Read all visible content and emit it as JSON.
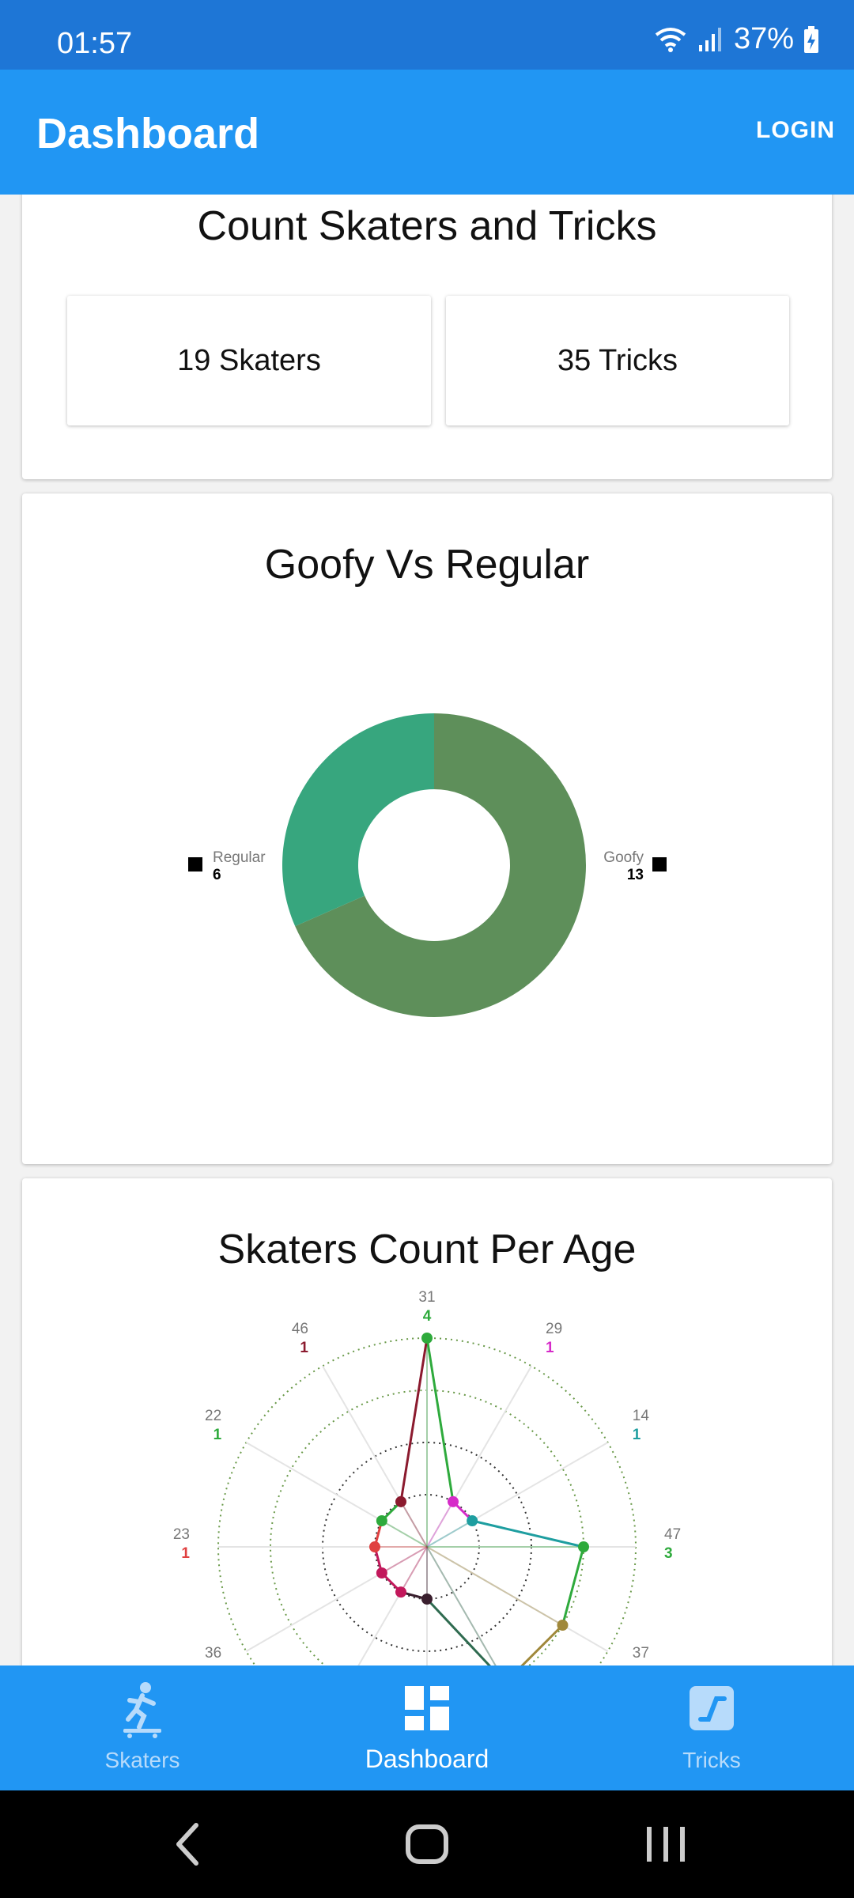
{
  "status_bar": {
    "time": "01:57",
    "battery": "37%"
  },
  "app_bar": {
    "title": "Dashboard",
    "login_label": "LOGIN"
  },
  "counts_card": {
    "title": "Count Skaters and Tricks",
    "skaters_label": "19 Skaters",
    "tricks_label": "35 Tricks"
  },
  "goofy_card": {
    "title": "Goofy Vs Regular"
  },
  "age_card": {
    "title": "Skaters Count Per Age"
  },
  "chart_data": [
    {
      "type": "pie",
      "variant": "donut",
      "slices": [
        {
          "label": "Goofy",
          "value": 13,
          "color": "#5e8f5a"
        },
        {
          "label": "Regular",
          "value": 6,
          "color": "#37a67e"
        }
      ]
    },
    {
      "type": "radar",
      "categories": [
        "31",
        "29",
        "14",
        "47",
        "37",
        "",
        "",
        "",
        "36",
        "23",
        "22",
        "46"
      ],
      "values": [
        4,
        1,
        1,
        3,
        3,
        3,
        1,
        1,
        1,
        1,
        1,
        1
      ],
      "value_labels": [
        "4",
        "1",
        "1",
        "3",
        "",
        "",
        "",
        "",
        "",
        "1",
        "1",
        "1"
      ],
      "colors": [
        "#2eaa3c",
        "#d62bc9",
        "#1e9ea0",
        "#2eaa3c",
        "#a0883a",
        "#2f6b50",
        "#3a1f2e",
        "#c2185b",
        "#c2185b",
        "#e04040",
        "#2eaa3c",
        "#8b1a2e"
      ],
      "rlim": [
        0,
        4
      ]
    }
  ],
  "bottom_nav": {
    "skaters": "Skaters",
    "dashboard": "Dashboard",
    "tricks": "Tricks"
  },
  "icons": {
    "wifi": "wifi-icon",
    "signal": "signal-icon",
    "battery": "battery-charging-icon",
    "skaters": "skateboarder-icon",
    "dashboard": "dashboard-icon",
    "tricks": "ramp-icon",
    "back": "back-icon",
    "home": "home-icon",
    "recents": "recents-icon"
  },
  "colors": {
    "primary": "#2196f3",
    "status": "#1e76d6",
    "goofy": "#5e8f5a",
    "regular": "#37a67e"
  }
}
